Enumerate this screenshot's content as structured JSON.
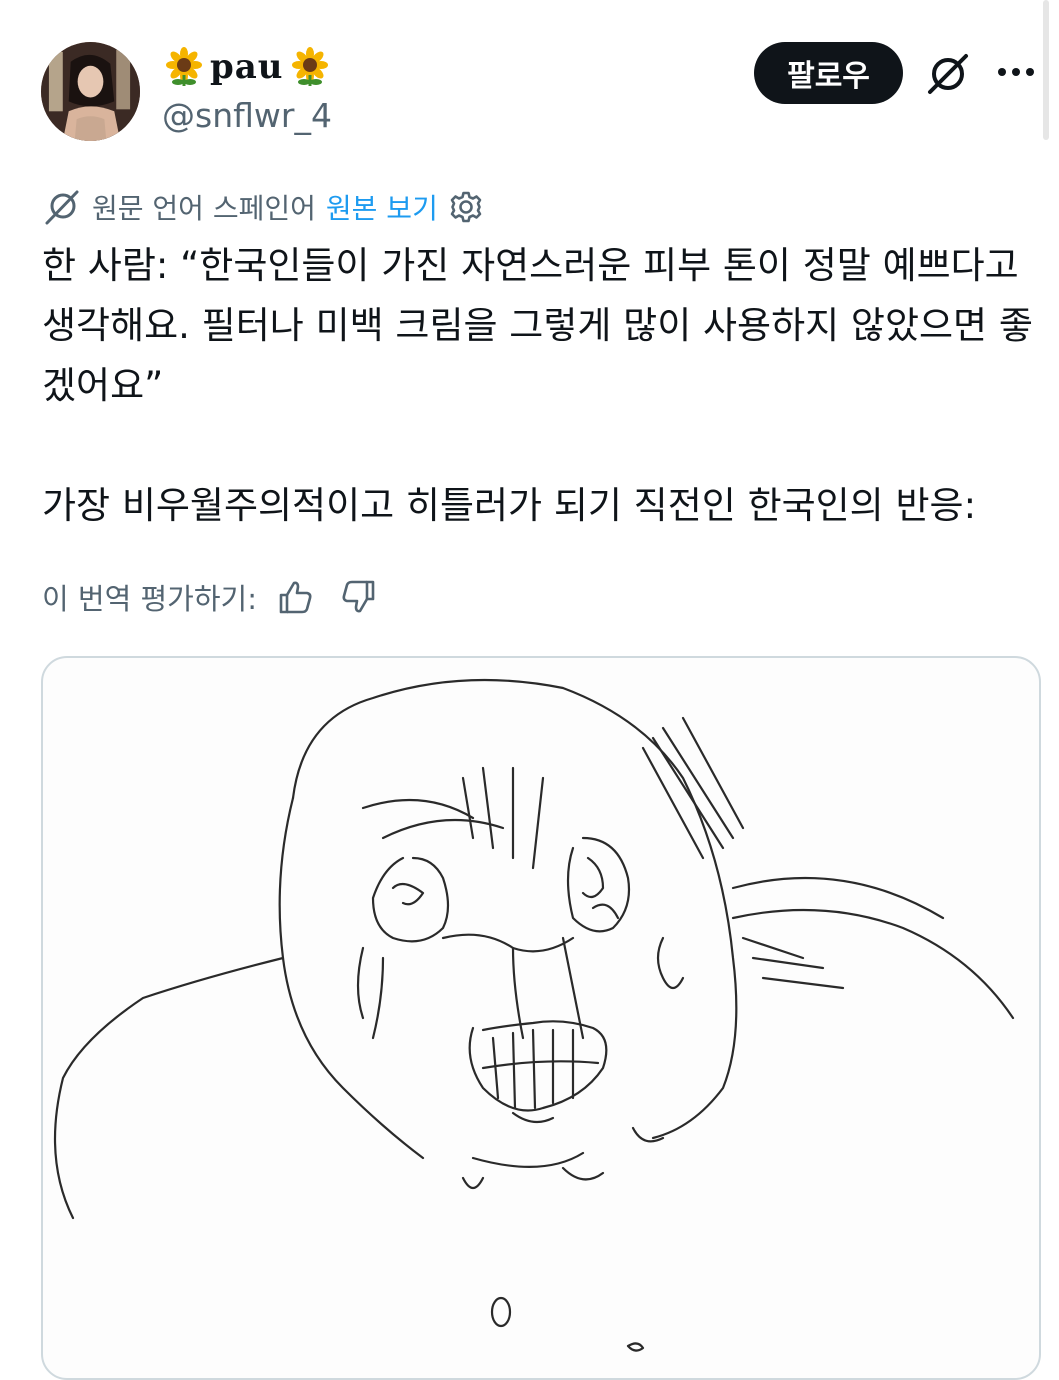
{
  "user": {
    "name": "pau",
    "handle": "@snflwr_4",
    "follow_label": "팔로우"
  },
  "translation": {
    "source_lang": "원문 언어 스페인어",
    "view_original": "원본 보기"
  },
  "tweet": {
    "quote": "한 사람: “한국인들이 가진 자연스러운 피부 톤이 정말 예쁘다고 생각해요. 필터나 미백 크림을 그렇게 많이 사용하지 않았으면 좋겠어요”",
    "reaction": "가장 비우월주의적이고 히틀러가 되기 직전인 한국인의 반응:"
  },
  "rate": {
    "label": "이 번역 평가하기:"
  },
  "colors": {
    "follow_bg": "#0f1419",
    "link": "#1d9bf0",
    "secondary_text": "#536471"
  }
}
